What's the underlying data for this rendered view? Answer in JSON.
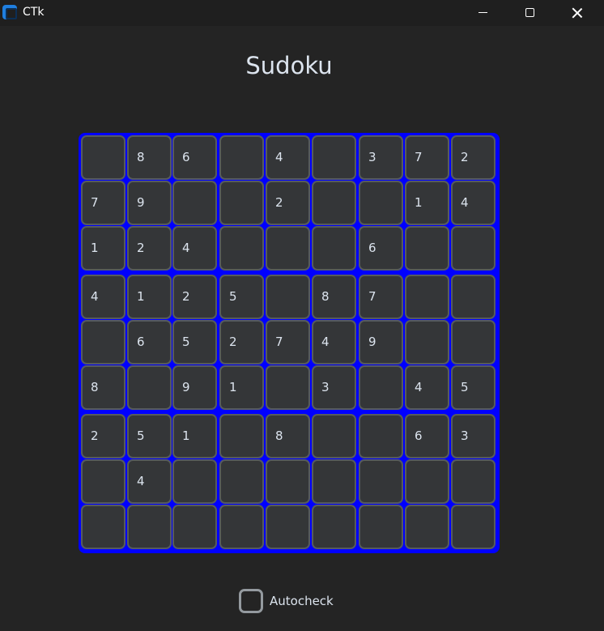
{
  "window": {
    "title": "CTk",
    "app_icon": "ctk-app-icon",
    "controls": [
      "minimize-icon",
      "maximize-icon",
      "close-icon"
    ]
  },
  "heading": "Sudoku",
  "board": {
    "rows": [
      [
        "",
        "8",
        "6",
        "",
        "4",
        "",
        "3",
        "7",
        "2"
      ],
      [
        "7",
        "9",
        "",
        "",
        "2",
        "",
        "",
        "1",
        "4"
      ],
      [
        "1",
        "2",
        "4",
        "",
        "",
        "",
        "6",
        "",
        ""
      ],
      [
        "4",
        "1",
        "2",
        "5",
        "",
        "8",
        "7",
        "",
        ""
      ],
      [
        "",
        "6",
        "5",
        "2",
        "7",
        "4",
        "9",
        "",
        ""
      ],
      [
        "8",
        "",
        "9",
        "1",
        "",
        "3",
        "",
        "4",
        "5"
      ],
      [
        "2",
        "5",
        "1",
        "",
        "8",
        "",
        "",
        "6",
        "3"
      ],
      [
        "",
        "4",
        "",
        "",
        "",
        "",
        "",
        "",
        ""
      ],
      [
        "",
        "",
        "",
        "",
        "",
        "",
        "",
        "",
        ""
      ]
    ]
  },
  "autocheck": {
    "label": "Autocheck",
    "checked": false
  },
  "colors": {
    "background": "#242424",
    "board_border": "#0000ff",
    "cell_fill": "#343638",
    "cell_border": "#565b5e",
    "text": "#dce4ee"
  }
}
